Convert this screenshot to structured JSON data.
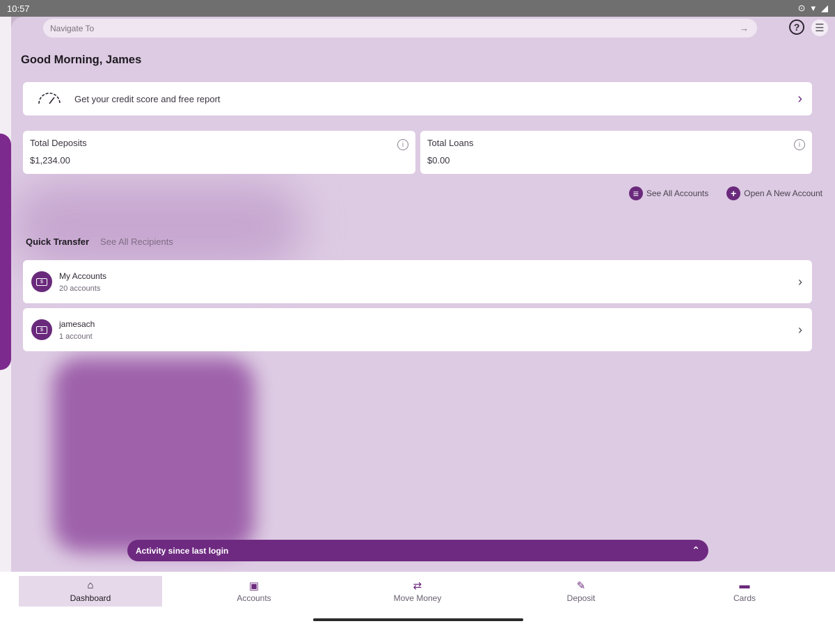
{
  "status_bar": {
    "time": "10:57"
  },
  "header": {
    "search_placeholder": "Navigate To"
  },
  "greeting": "Good Morning, James",
  "credit_banner": {
    "label": "Get your credit score and free report"
  },
  "stats": [
    {
      "label": "Total Deposits",
      "value": "$1,234.00"
    },
    {
      "label": "Total Loans",
      "value": "$0.00"
    }
  ],
  "account_links": {
    "see_all": "See All Accounts",
    "open_new": "Open A New Account"
  },
  "quick_transfer": {
    "title": "Quick Transfer",
    "see_all": "See All Recipients",
    "recipients": [
      {
        "name": "My Accounts",
        "sub": "20 accounts"
      },
      {
        "name": "jamesach",
        "sub": "1 account"
      }
    ]
  },
  "activity": {
    "label": "Activity since last login"
  },
  "bottom_nav": {
    "items": [
      {
        "label": "Dashboard",
        "icon": "home-icon"
      },
      {
        "label": "Accounts",
        "icon": "money-icon"
      },
      {
        "label": "Move Money",
        "icon": "transfer-icon"
      },
      {
        "label": "Deposit",
        "icon": "check-deposit-icon"
      },
      {
        "label": "Cards",
        "icon": "card-icon"
      }
    ]
  },
  "colors": {
    "accent": "#6e2a81",
    "background": "#ddcbe3"
  }
}
